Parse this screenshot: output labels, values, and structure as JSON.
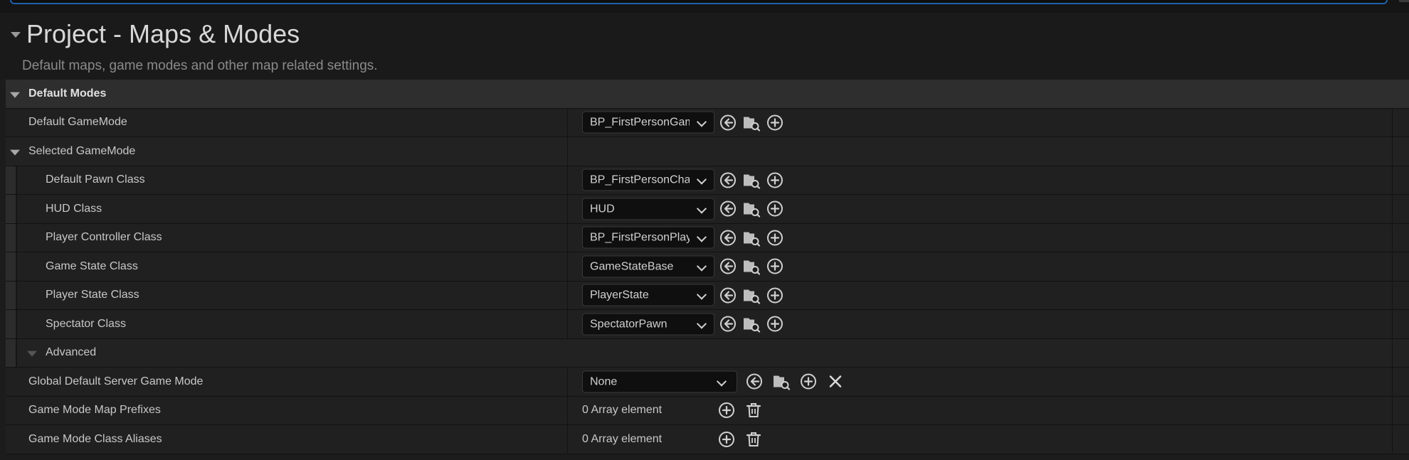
{
  "page": {
    "title": "Project - Maps & Modes",
    "subtitle": "Default maps, game modes and other map related settings."
  },
  "sections": {
    "default_modes": "Default Modes",
    "selected_gamemode": "Selected GameMode",
    "advanced": "Advanced"
  },
  "rows": {
    "default_gamemode": {
      "label": "Default GameMode",
      "value": "BP_FirstPersonGameMode"
    },
    "default_pawn": {
      "label": "Default Pawn Class",
      "value": "BP_FirstPersonCharacter"
    },
    "hud": {
      "label": "HUD Class",
      "value": "HUD"
    },
    "player_controller": {
      "label": "Player Controller Class",
      "value": "BP_FirstPersonPlayerController"
    },
    "game_state": {
      "label": "Game State Class",
      "value": "GameStateBase"
    },
    "player_state": {
      "label": "Player State Class",
      "value": "PlayerState"
    },
    "spectator": {
      "label": "Spectator Class",
      "value": "SpectatorPawn"
    },
    "global_server_gamemode": {
      "label": "Global Default Server Game Mode",
      "value": "None"
    },
    "map_prefixes": {
      "label": "Game Mode Map Prefixes",
      "value": "0 Array element"
    },
    "class_aliases": {
      "label": "Game Mode Class Aliases",
      "value": "0 Array element"
    }
  },
  "icons": {
    "use_selected": "use-selected-icon",
    "browse": "browse-folder-icon",
    "add": "add-icon",
    "clear": "clear-icon",
    "delete": "trash-icon"
  },
  "colors": {
    "panel": "#1c1c1c",
    "category_row": "#2e2e2e",
    "focus_border": "#1f5fa9"
  }
}
